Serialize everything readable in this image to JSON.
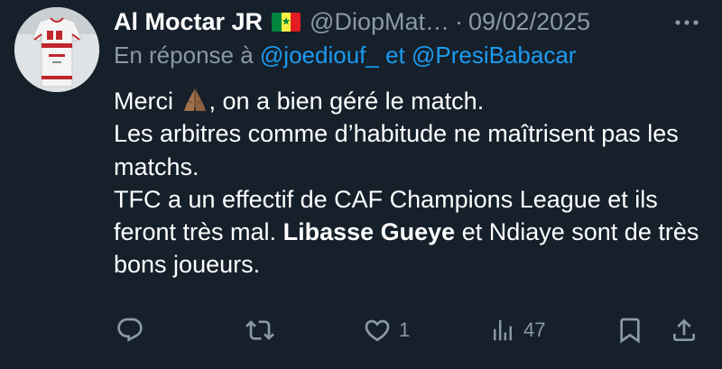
{
  "tweet": {
    "author": {
      "display_name": "Al Moctar JR",
      "flag_icon": "senegal-flag-icon",
      "handle": "@DiopMat…",
      "separator": "·",
      "date": "09/02/2025"
    },
    "reply_to": {
      "prefix": "En réponse à",
      "mention_1": "@joediouf_",
      "conjunction": "et",
      "mention_2": "@PresiBabacar"
    },
    "body": {
      "line1_before_emoji": "Merci",
      "emoji": "folded-hands-icon",
      "line1_after_emoji": ", on a bien géré le match.",
      "line2": "Les arbitres comme d’habitude ne maîtrisent pas les matchs.",
      "line3_start": "TFC a un effectif de CAF Champions League et ils feront très mal.",
      "line3_bold": "Libasse Gueye",
      "line3_end": "et Ndiaye sont de très bons joueurs."
    },
    "actions": {
      "reply": {
        "icon": "reply-icon",
        "count": ""
      },
      "retweet": {
        "icon": "retweet-icon",
        "count": ""
      },
      "like": {
        "icon": "heart-icon",
        "count": "1"
      },
      "views": {
        "icon": "views-icon",
        "count": "47"
      },
      "bookmark": {
        "icon": "bookmark-icon"
      },
      "share": {
        "icon": "share-icon"
      }
    }
  },
  "colors": {
    "background": "#15202b",
    "text_primary": "#ffffff",
    "text_secondary": "#8b98a5",
    "link": "#1d9bf0",
    "flag_green": "#00853f",
    "flag_yellow": "#fdef42",
    "flag_red": "#e31b23"
  }
}
